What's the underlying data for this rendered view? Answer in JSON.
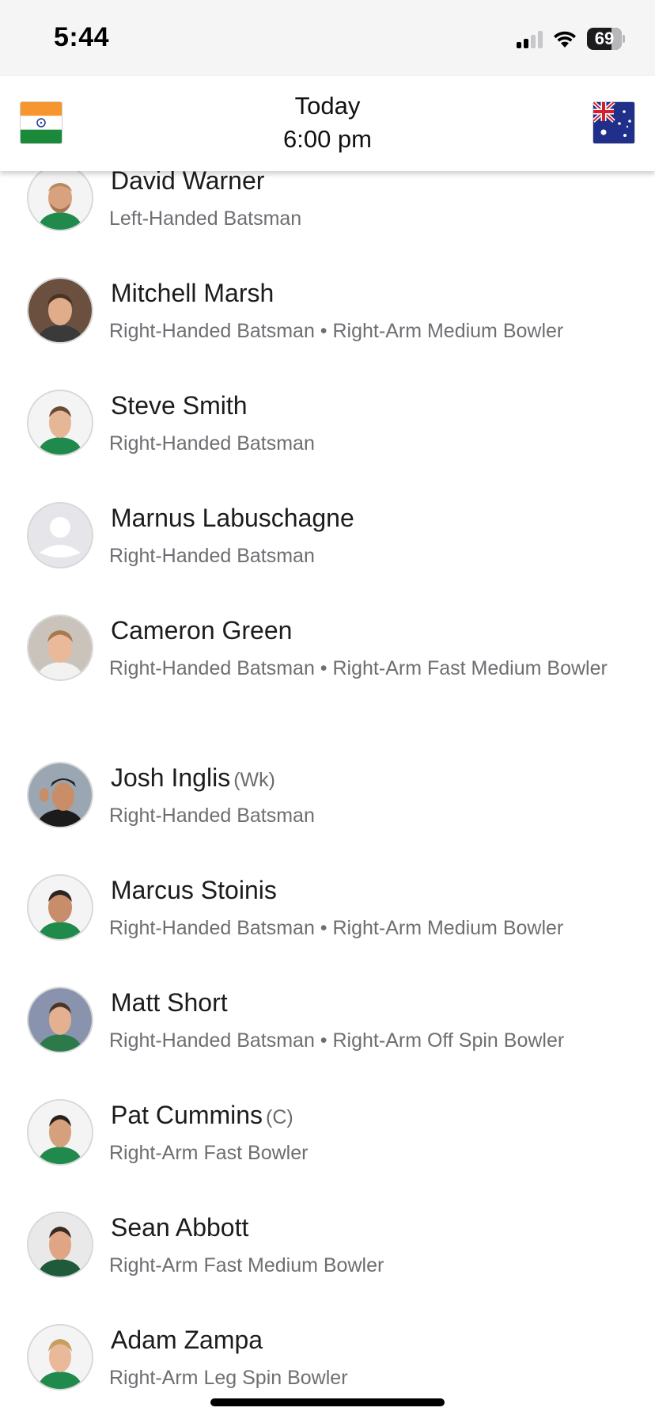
{
  "status_bar": {
    "time": "5:44",
    "battery": "69",
    "icons": [
      "cellular-signal-icon",
      "wifi-icon",
      "battery-icon"
    ]
  },
  "header": {
    "day": "Today",
    "time": "6:00 pm",
    "left_flag": "india-flag-icon",
    "right_flag": "australia-flag-icon"
  },
  "players": [
    {
      "name": "David Warner",
      "tag": "",
      "role": "Left-Handed Batsman"
    },
    {
      "name": "Mitchell Marsh",
      "tag": "",
      "role": "Right-Handed Batsman • Right-Arm Medium Bowler"
    },
    {
      "name": "Steve Smith",
      "tag": "",
      "role": "Right-Handed Batsman"
    },
    {
      "name": "Marnus Labuschagne",
      "tag": "",
      "role": "Right-Handed Batsman"
    },
    {
      "name": "Cameron Green",
      "tag": "",
      "role": "Right-Handed Batsman • Right-Arm Fast Medium Bowler"
    },
    {
      "name": "Josh Inglis",
      "tag": "(Wk)",
      "role": "Right-Handed Batsman"
    },
    {
      "name": "Marcus Stoinis",
      "tag": "",
      "role": "Right-Handed Batsman • Right-Arm Medium Bowler"
    },
    {
      "name": "Matt Short",
      "tag": "",
      "role": "Right-Handed Batsman • Right-Arm Off Spin Bowler"
    },
    {
      "name": "Pat Cummins",
      "tag": "(C)",
      "role": "Right-Arm Fast Bowler"
    },
    {
      "name": "Sean Abbott",
      "tag": "",
      "role": "Right-Arm Fast Medium Bowler"
    },
    {
      "name": "Adam Zampa",
      "tag": "",
      "role": "Right-Arm Leg Spin Bowler"
    }
  ]
}
